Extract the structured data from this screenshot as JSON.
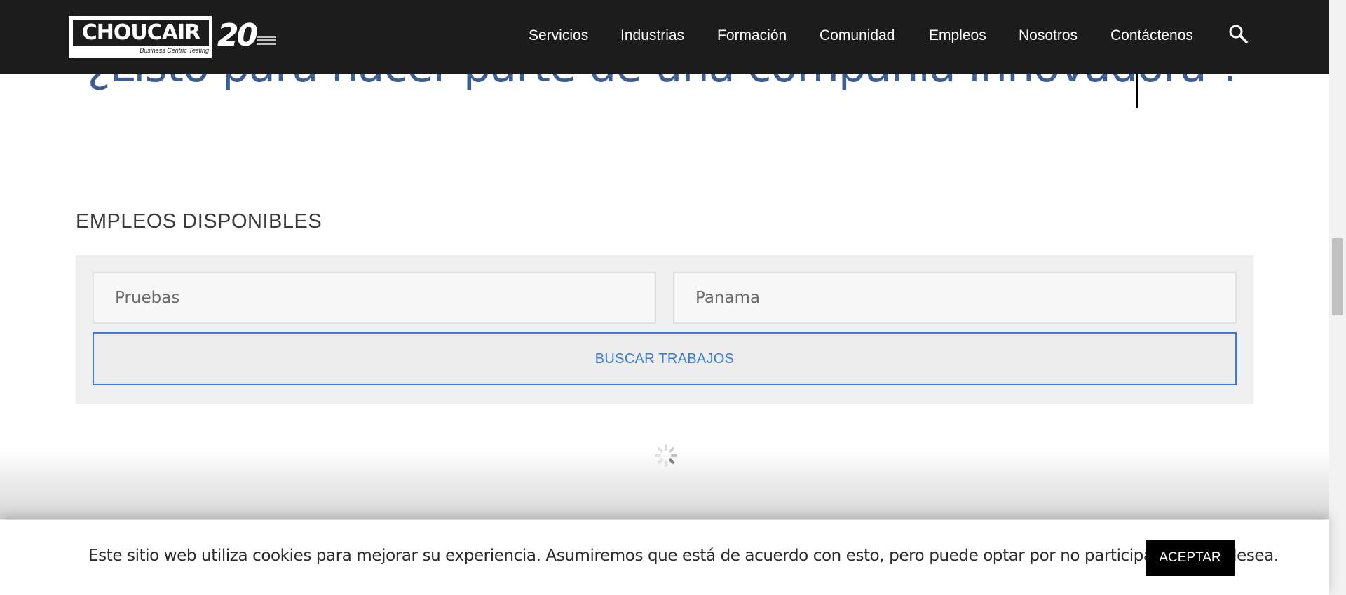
{
  "header": {
    "logo": {
      "word": "CHOUCAIR",
      "tagline": "Business Centric Testing",
      "anniversary": "20"
    },
    "nav": [
      "Servicios",
      "Industrias",
      "Formación",
      "Comunidad",
      "Empleos",
      "Nosotros",
      "Contáctenos"
    ],
    "search_icon": "search-icon"
  },
  "hero": {
    "heading": "¿Listo para hacer parte de una compañía innovadora ?"
  },
  "jobs": {
    "title": "EMPLEOS DISPONIBLES",
    "keyword_placeholder": "Pruebas",
    "location_placeholder": "Panama",
    "search_button": "BUSCAR TRABAJOS"
  },
  "cookie": {
    "text": "Este sitio web utiliza cookies para mejorar su experiencia. Asumiremos que está de acuerdo con esto, pero puede optar por no participar si así lo desea.",
    "accept": "ACEPTAR"
  },
  "colors": {
    "header_bg": "#1c1c1c",
    "heading": "#3e5d8f",
    "accent": "#3a7bd5"
  }
}
